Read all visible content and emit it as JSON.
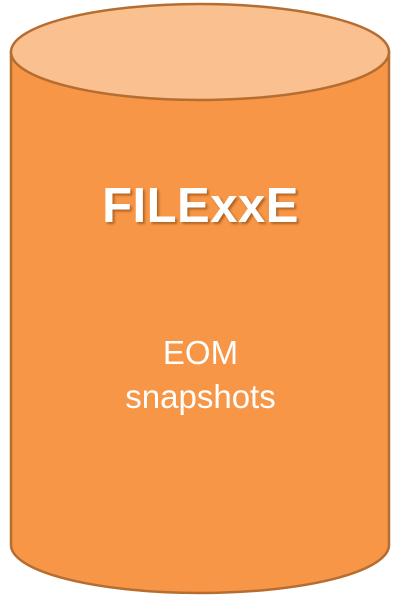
{
  "database": {
    "title": "FILExxE",
    "subtitle_lines": [
      "EOM",
      "snapshots"
    ],
    "colors": {
      "body_fill": "#F79646",
      "top_fill": "#FAC08F",
      "stroke": "#B66D31",
      "text": "#FFFFFF"
    }
  }
}
